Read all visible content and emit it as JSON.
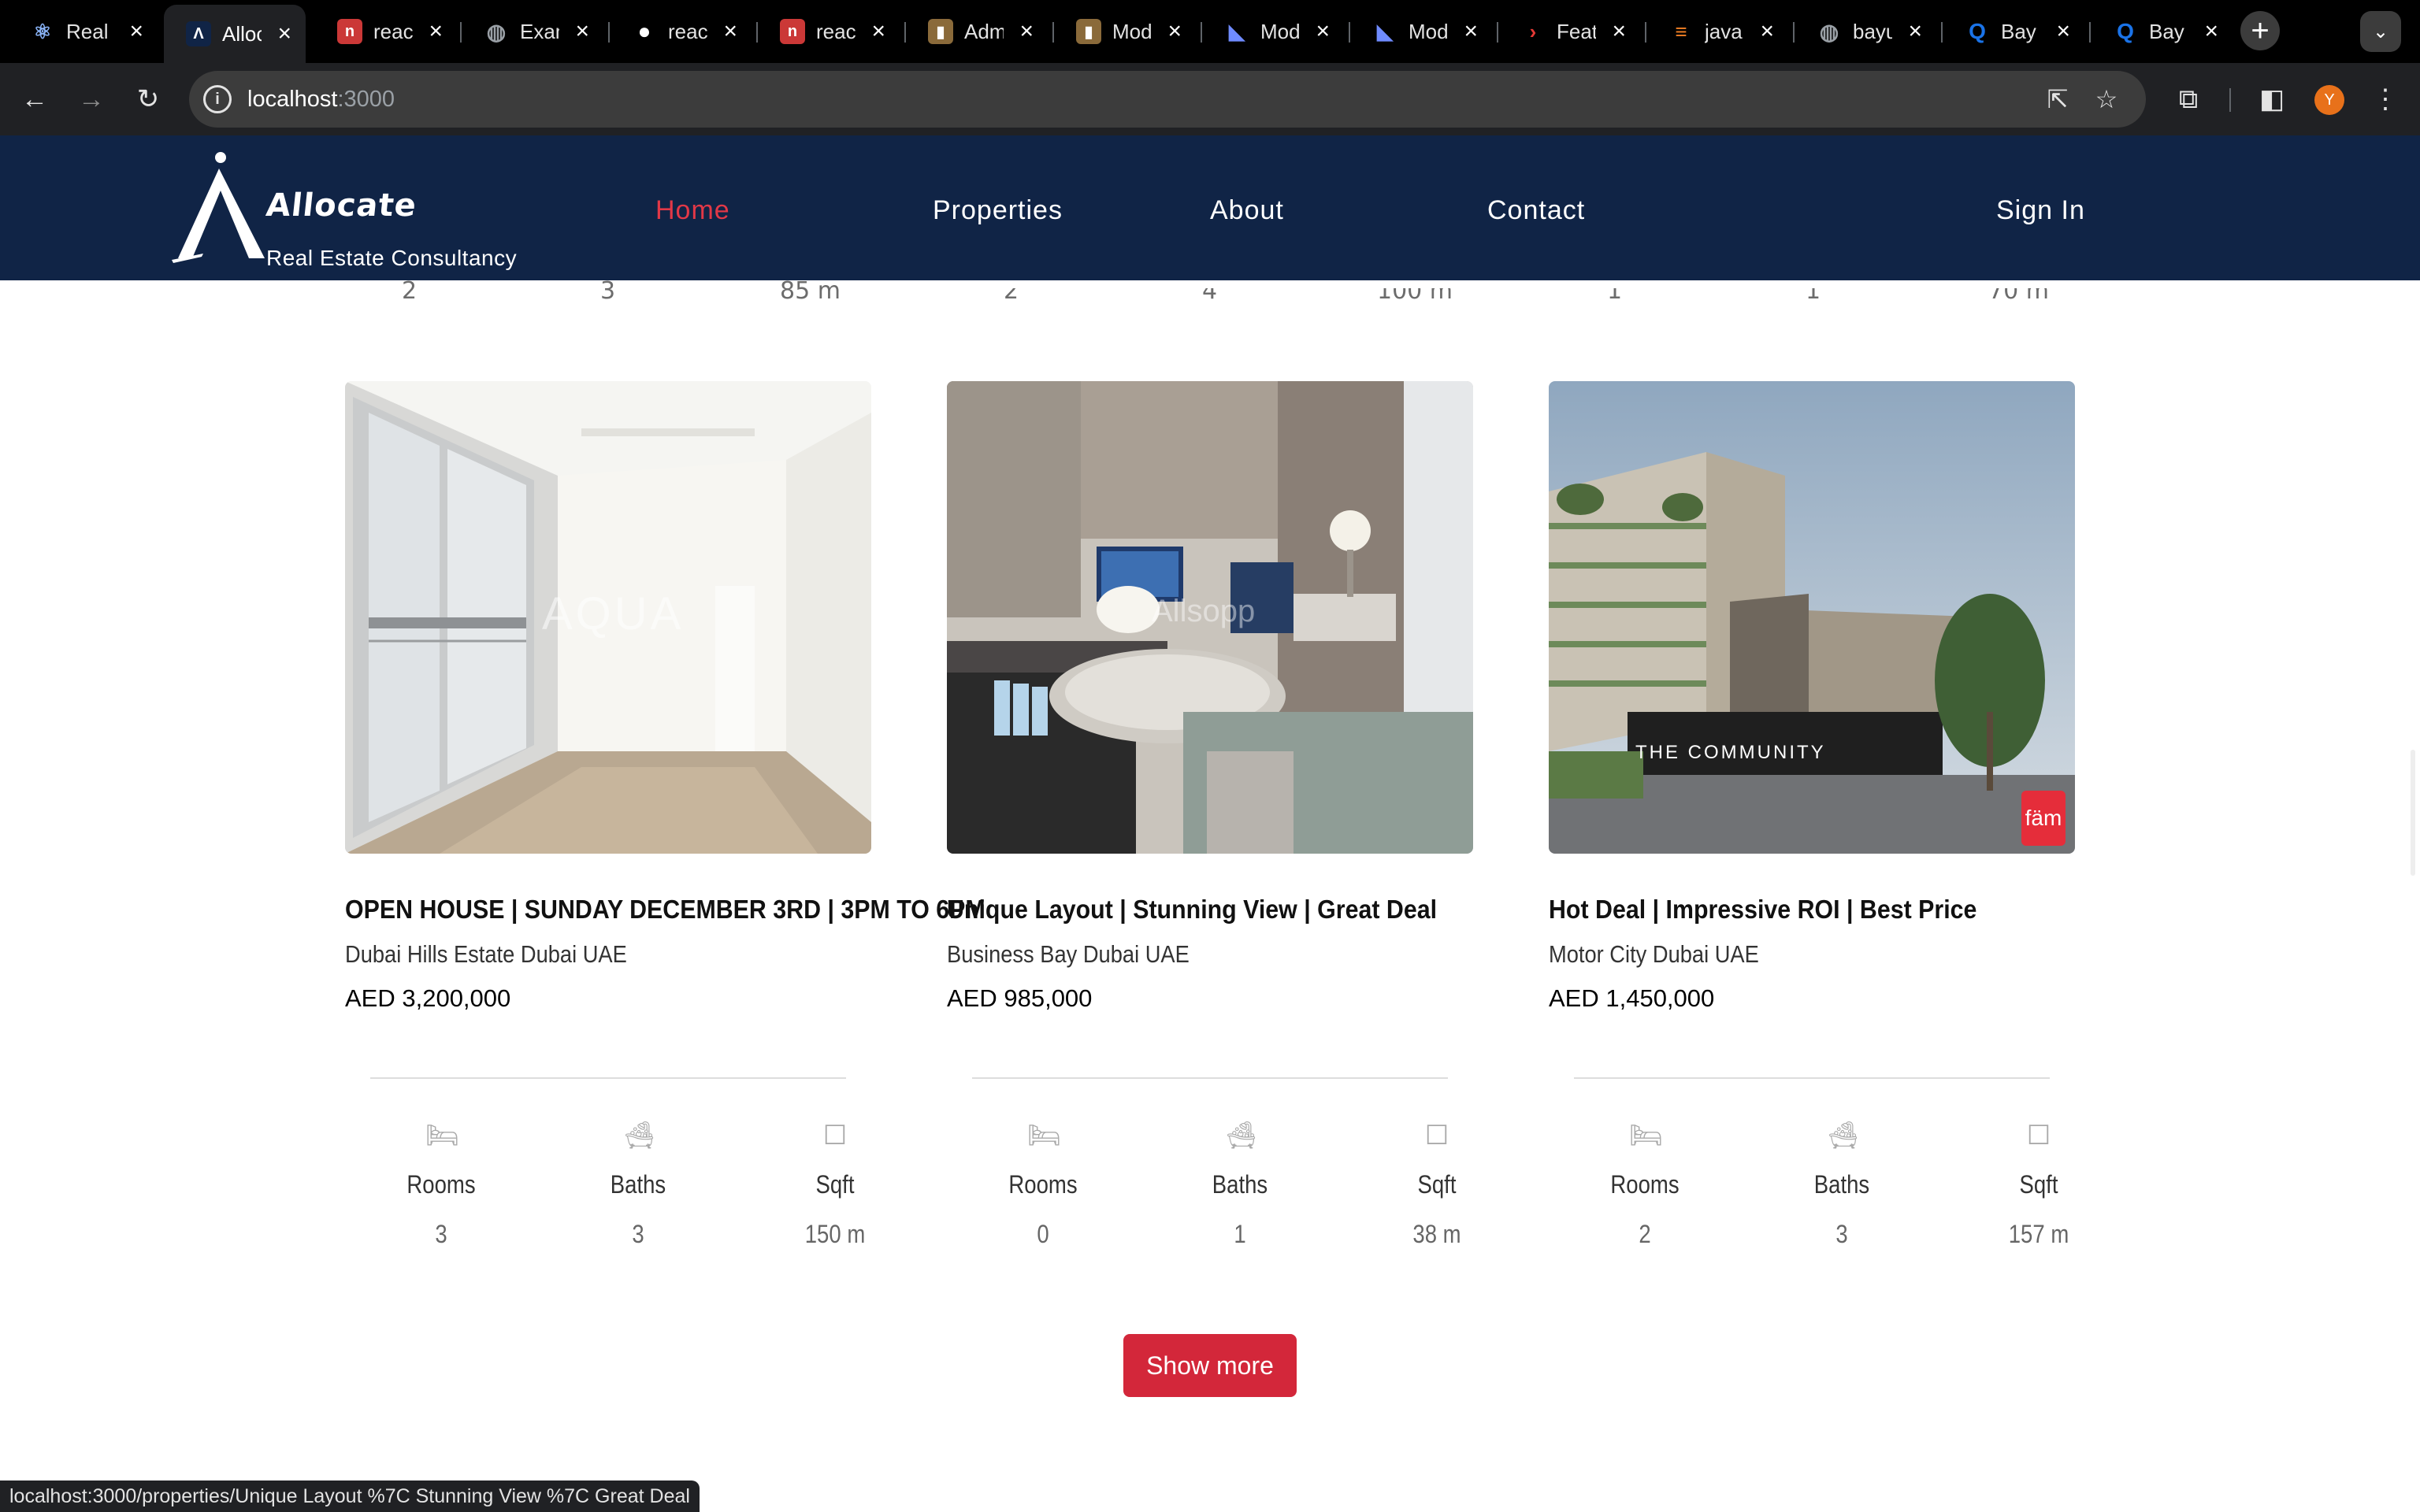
{
  "browser": {
    "tabs": [
      {
        "title": "Real",
        "icon": "react-icon"
      },
      {
        "title": "Allocate",
        "icon": "allocate-logo-icon",
        "active": true
      },
      {
        "title": "react",
        "icon": "npm-icon"
      },
      {
        "title": "Exam",
        "icon": "globe-icon"
      },
      {
        "title": "react",
        "icon": "github-icon"
      },
      {
        "title": "react",
        "icon": "npm-icon"
      },
      {
        "title": "Admin",
        "icon": "bookmark-icon"
      },
      {
        "title": "Mod",
        "icon": "bookmark-icon"
      },
      {
        "title": "Mod",
        "icon": "mui-icon"
      },
      {
        "title": "Mod",
        "icon": "mui-icon"
      },
      {
        "title": "Feat",
        "icon": "arrow-icon"
      },
      {
        "title": "java",
        "icon": "stackoverflow-icon"
      },
      {
        "title": "bayu",
        "icon": "globe-icon"
      },
      {
        "title": "Bay",
        "icon": "search-q-icon"
      },
      {
        "title": "Bay",
        "icon": "search-q-icon"
      }
    ],
    "url_host": "localhost",
    "url_port": ":3000",
    "avatar_letter": "Y",
    "status_url": "localhost:3000/properties/Unique Layout %7C Stunning View %7C Great Deal"
  },
  "site": {
    "brand": "Allocate",
    "tagline": "Real Estate Consultancy",
    "nav": [
      "Home",
      "Properties",
      "About",
      "Contact"
    ],
    "signin": "Sign In",
    "colors": {
      "navbar": "#102446",
      "accent": "#e23847",
      "button": "#d3273a"
    }
  },
  "previous_row_stats": [
    "2",
    "3",
    "85 m",
    "2",
    "4",
    "100 m",
    "1",
    "1",
    "70 m"
  ],
  "properties": [
    {
      "title": "OPEN HOUSE | SUNDAY DECEMBER 3RD | 3PM TO 6PM",
      "location": "Dubai Hills Estate Dubai UAE",
      "price": "AED 3,200,000",
      "rooms": "3",
      "baths": "3",
      "sqft": "150 m",
      "watermark": "AQUA"
    },
    {
      "title": "Unique Layout | Stunning View | Great Deal",
      "location": "Business Bay Dubai UAE",
      "price": "AED 985,000",
      "rooms": "0",
      "baths": "1",
      "sqft": "38 m",
      "watermark": "Allsopp"
    },
    {
      "title": "Hot Deal | Impressive ROI | Best Price",
      "location": "Motor City Dubai UAE",
      "price": "AED 1,450,000",
      "rooms": "2",
      "baths": "3",
      "sqft": "157 m",
      "watermark": "THE COMMUNITY",
      "badge": "fäm"
    }
  ],
  "labels": {
    "rooms": "Rooms",
    "baths": "Baths",
    "sqft": "Sqft"
  },
  "show_more": "Show more"
}
